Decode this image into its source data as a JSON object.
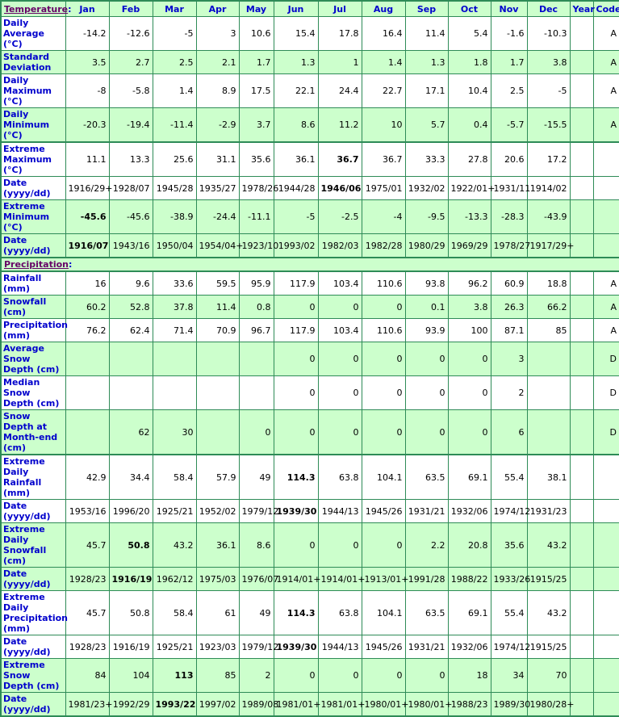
{
  "header": {
    "section": "Temperature",
    "months": [
      "Jan",
      "Feb",
      "Mar",
      "Apr",
      "May",
      "Jun",
      "Jul",
      "Aug",
      "Sep",
      "Oct",
      "Nov",
      "Dec"
    ],
    "year": "Year",
    "code": "Code"
  },
  "temperature_rows": [
    {
      "label": "Daily Average (°C)",
      "values": [
        "-14.2",
        "-12.6",
        "-5",
        "3",
        "10.6",
        "15.4",
        "17.8",
        "16.4",
        "11.4",
        "5.4",
        "-1.6",
        "-10.3"
      ],
      "year": "",
      "code": "A",
      "bold": []
    },
    {
      "label": "Standard Deviation",
      "values": [
        "3.5",
        "2.7",
        "2.5",
        "2.1",
        "1.7",
        "1.3",
        "1",
        "1.4",
        "1.3",
        "1.8",
        "1.7",
        "3.8"
      ],
      "year": "",
      "code": "A",
      "bold": []
    },
    {
      "label": "Daily Maximum (°C)",
      "values": [
        "-8",
        "-5.8",
        "1.4",
        "8.9",
        "17.5",
        "22.1",
        "24.4",
        "22.7",
        "17.1",
        "10.4",
        "2.5",
        "-5"
      ],
      "year": "",
      "code": "A",
      "bold": []
    },
    {
      "label": "Daily Minimum (°C)",
      "values": [
        "-20.3",
        "-19.4",
        "-11.4",
        "-2.9",
        "3.7",
        "8.6",
        "11.2",
        "10",
        "5.7",
        "0.4",
        "-5.7",
        "-15.5"
      ],
      "year": "",
      "code": "A",
      "bold": []
    },
    {
      "label": "Extreme Maximum (°C)",
      "values": [
        "11.1",
        "13.3",
        "25.6",
        "31.1",
        "35.6",
        "36.1",
        "36.7",
        "36.7",
        "33.3",
        "27.8",
        "20.6",
        "17.2"
      ],
      "year": "",
      "code": "",
      "bold": [
        6
      ]
    },
    {
      "label": "Date (yyyy/dd)",
      "values": [
        "1916/29+",
        "1928/07",
        "1945/28",
        "1935/27",
        "1978/26",
        "1944/28",
        "1946/06",
        "1975/01",
        "1932/02",
        "1922/01+",
        "1931/11",
        "1914/02"
      ],
      "year": "",
      "code": "",
      "bold": [
        6
      ]
    },
    {
      "label": "Extreme Minimum (°C)",
      "values": [
        "-45.6",
        "-45.6",
        "-38.9",
        "-24.4",
        "-11.1",
        "-5",
        "-2.5",
        "-4",
        "-9.5",
        "-13.3",
        "-28.3",
        "-43.9"
      ],
      "year": "",
      "code": "",
      "bold": [
        0
      ]
    },
    {
      "label": "Date (yyyy/dd)",
      "values": [
        "1916/07",
        "1943/16",
        "1950/04",
        "1954/04+",
        "1923/10",
        "1993/02",
        "1982/03",
        "1982/28",
        "1980/29",
        "1969/29",
        "1978/27",
        "1917/29+"
      ],
      "year": "",
      "code": "",
      "bold": [
        0
      ]
    }
  ],
  "precip_section": "Precipitation",
  "precip_rows": [
    {
      "label": "Rainfall (mm)",
      "values": [
        "16",
        "9.6",
        "33.6",
        "59.5",
        "95.9",
        "117.9",
        "103.4",
        "110.6",
        "93.8",
        "96.2",
        "60.9",
        "18.8"
      ],
      "year": "",
      "code": "A",
      "bold": []
    },
    {
      "label": "Snowfall (cm)",
      "values": [
        "60.2",
        "52.8",
        "37.8",
        "11.4",
        "0.8",
        "0",
        "0",
        "0",
        "0.1",
        "3.8",
        "26.3",
        "66.2"
      ],
      "year": "",
      "code": "A",
      "bold": []
    },
    {
      "label": "Precipitation (mm)",
      "values": [
        "76.2",
        "62.4",
        "71.4",
        "70.9",
        "96.7",
        "117.9",
        "103.4",
        "110.6",
        "93.9",
        "100",
        "87.1",
        "85"
      ],
      "year": "",
      "code": "A",
      "bold": []
    },
    {
      "label": "Average Snow Depth (cm)",
      "values": [
        "",
        "",
        "",
        "",
        "",
        "0",
        "0",
        "0",
        "0",
        "0",
        "3",
        ""
      ],
      "year": "",
      "code": "D",
      "bold": []
    },
    {
      "label": "Median Snow Depth (cm)",
      "values": [
        "",
        "",
        "",
        "",
        "",
        "0",
        "0",
        "0",
        "0",
        "0",
        "2",
        ""
      ],
      "year": "",
      "code": "D",
      "bold": []
    },
    {
      "label": "Snow Depth at Month-end (cm)",
      "values": [
        "",
        "62",
        "30",
        "",
        "0",
        "0",
        "0",
        "0",
        "0",
        "0",
        "6",
        ""
      ],
      "year": "",
      "code": "D",
      "bold": []
    },
    {
      "label": "Extreme Daily Rainfall (mm)",
      "values": [
        "42.9",
        "34.4",
        "58.4",
        "57.9",
        "49",
        "114.3",
        "63.8",
        "104.1",
        "63.5",
        "69.1",
        "55.4",
        "38.1"
      ],
      "year": "",
      "code": "",
      "bold": [
        5
      ]
    },
    {
      "label": "Date (yyyy/dd)",
      "values": [
        "1953/16",
        "1996/20",
        "1925/21",
        "1952/02",
        "1979/12",
        "1939/30",
        "1944/13",
        "1945/26",
        "1931/21",
        "1932/06",
        "1974/12",
        "1931/23"
      ],
      "year": "",
      "code": "",
      "bold": [
        5
      ]
    },
    {
      "label": "Extreme Daily Snowfall (cm)",
      "values": [
        "45.7",
        "50.8",
        "43.2",
        "36.1",
        "8.6",
        "0",
        "0",
        "0",
        "2.2",
        "20.8",
        "35.6",
        "43.2"
      ],
      "year": "",
      "code": "",
      "bold": [
        1
      ]
    },
    {
      "label": "Date (yyyy/dd)",
      "values": [
        "1928/23",
        "1916/19",
        "1962/12",
        "1975/03",
        "1976/07",
        "1914/01+",
        "1914/01+",
        "1913/01+",
        "1991/28",
        "1988/22",
        "1933/26",
        "1915/25"
      ],
      "year": "",
      "code": "",
      "bold": [
        1
      ]
    },
    {
      "label": "Extreme Daily Precipitation (mm)",
      "values": [
        "45.7",
        "50.8",
        "58.4",
        "61",
        "49",
        "114.3",
        "63.8",
        "104.1",
        "63.5",
        "69.1",
        "55.4",
        "43.2"
      ],
      "year": "",
      "code": "",
      "bold": [
        5
      ]
    },
    {
      "label": "Date (yyyy/dd)",
      "values": [
        "1928/23",
        "1916/19",
        "1925/21",
        "1923/03",
        "1979/12",
        "1939/30",
        "1944/13",
        "1945/26",
        "1931/21",
        "1932/06",
        "1974/12",
        "1915/25"
      ],
      "year": "",
      "code": "",
      "bold": [
        5
      ]
    },
    {
      "label": "Extreme Snow Depth (cm)",
      "values": [
        "84",
        "104",
        "113",
        "85",
        "2",
        "0",
        "0",
        "0",
        "0",
        "18",
        "34",
        "70"
      ],
      "year": "",
      "code": "",
      "bold": [
        2
      ]
    },
    {
      "label": "Date (yyyy/dd)",
      "values": [
        "1981/23+",
        "1992/29",
        "1993/22",
        "1997/02",
        "1989/08",
        "1981/01+",
        "1981/01+",
        "1980/01+",
        "1980/01+",
        "1988/23",
        "1989/30",
        "1980/28+"
      ],
      "year": "",
      "code": "",
      "bold": [
        2
      ]
    }
  ],
  "row_shading": {
    "temperature": [
      "w",
      "g",
      "w",
      "g",
      "w",
      "w",
      "g",
      "g"
    ],
    "precipitation": [
      "w",
      "g",
      "w",
      "g",
      "w",
      "g",
      "w",
      "w",
      "g",
      "g",
      "w",
      "w",
      "g",
      "g"
    ]
  },
  "colors": {
    "border": "#2e8b57",
    "header_bg": "#ccffcc",
    "label_text": "#0000cc",
    "section_link": "#660066"
  }
}
